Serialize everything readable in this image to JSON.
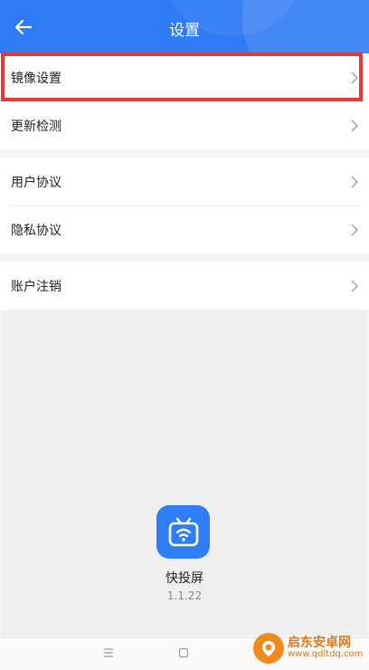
{
  "header": {
    "title": "设置"
  },
  "groups": [
    {
      "items": [
        {
          "label": "镜像设置"
        },
        {
          "label": "更新检测"
        }
      ]
    },
    {
      "items": [
        {
          "label": "用户协议"
        },
        {
          "label": "隐私协议"
        }
      ]
    },
    {
      "items": [
        {
          "label": "账户注销"
        }
      ]
    }
  ],
  "about": {
    "app_name": "快投屏",
    "version": "1.1.22"
  },
  "watermark": {
    "name": "启东安卓网",
    "url": "www.qdltdq.com"
  },
  "colors": {
    "header_bg": "#2f7bf5",
    "highlight": "#e53935",
    "app_icon_bg": "#2f7ef6"
  },
  "icons": [
    "back-arrow-icon",
    "chevron-right-icon",
    "tv-wifi-icon",
    "menu-lines-icon",
    "square-home-icon"
  ]
}
